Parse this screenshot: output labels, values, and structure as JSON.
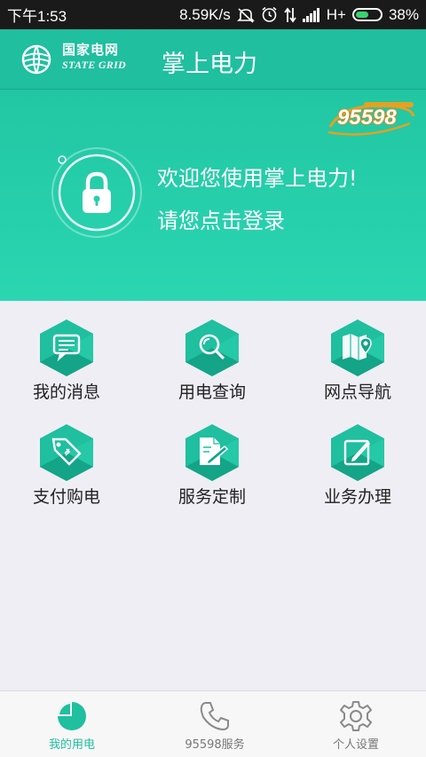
{
  "status_bar": {
    "time": "下午1:53",
    "network_speed": "8.59K/s",
    "network_type": "H+",
    "battery": "38%",
    "icons": [
      "mute-icon",
      "alarm-icon",
      "data-arrows-icon",
      "signal-icon",
      "battery-icon"
    ]
  },
  "header": {
    "logo_cn": "国家电网",
    "logo_en": "STATE GRID",
    "title": "掌上电力"
  },
  "banner": {
    "hotline": "95598",
    "welcome": "欢迎您使用掌上电力!",
    "login_prompt": "请您点击登录"
  },
  "menu": [
    {
      "label": "我的消息",
      "icon": "message-icon"
    },
    {
      "label": "用电查询",
      "icon": "search-icon"
    },
    {
      "label": "网点导航",
      "icon": "map-icon"
    },
    {
      "label": "支付购电",
      "icon": "price-tag-icon"
    },
    {
      "label": "服务定制",
      "icon": "document-edit-icon"
    },
    {
      "label": "业务办理",
      "icon": "edit-icon"
    }
  ],
  "bottom_nav": [
    {
      "label": "我的用电",
      "icon": "pie-chart-icon",
      "active": true
    },
    {
      "label": "95598服务",
      "icon": "phone-icon",
      "active": false
    },
    {
      "label": "个人设置",
      "icon": "gear-icon",
      "active": false
    }
  ],
  "colors": {
    "brand": "#1fbf9f",
    "banner": "#26cfac",
    "hex_light": "#2ec4a1",
    "hex_dark": "#14a487",
    "hotline_gold": "#e8a021"
  }
}
